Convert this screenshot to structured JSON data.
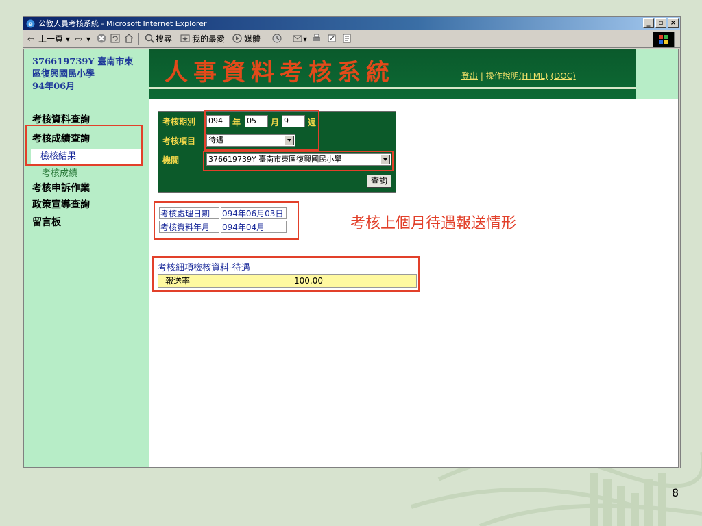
{
  "window": {
    "title": "公教人員考核系統 - Microsoft Internet Explorer"
  },
  "toolbar": {
    "back_label": "上一頁",
    "search_label": "搜尋",
    "favorites_label": "我的最愛",
    "media_label": "媒體"
  },
  "sidebar": {
    "school_lines": [
      "376619739Y 臺南市東",
      "區復興國民小學",
      "94年06月"
    ],
    "items": [
      {
        "label": "考核資料查詢"
      },
      {
        "label": "考核成績查詢"
      },
      {
        "label": "考核申訴作業"
      },
      {
        "label": "政策宣導查詢"
      },
      {
        "label": "留言板"
      }
    ],
    "subitems": [
      {
        "label": "檢核結果",
        "active": true
      },
      {
        "label": "考核成績",
        "active": false
      }
    ]
  },
  "banner": {
    "title": "人事資料考核系統",
    "logout_label": "登出",
    "separator": "|",
    "help_label": "操作說明",
    "help_html": "(HTML)",
    "help_doc": "(DOC)"
  },
  "query": {
    "period_label": "考核期別",
    "year_value": "094",
    "year_unit": "年",
    "month_value": "05",
    "month_unit": "月",
    "week_value": "9",
    "week_unit": "週",
    "item_label": "考核項目",
    "item_value": "待遇",
    "org_label": "機關",
    "org_value": "376619739Y 臺南市東區復興國民小學",
    "submit_label": "查詢"
  },
  "info": {
    "process_date_label": "考核處理日期",
    "process_date_value": "094年06月03日",
    "data_month_label": "考核資料年月",
    "data_month_value": "094年04月"
  },
  "annotation": "考核上個月待遇報送情形",
  "detail": {
    "title": "考核細項檢核資料-待遇",
    "rows": [
      {
        "name": "報送率",
        "value": "100.00"
      }
    ]
  },
  "page_number": "8",
  "colors": {
    "accent_red": "#e2402a",
    "nav_green": "#b7edc7",
    "banner_green": "#0c6a34"
  }
}
